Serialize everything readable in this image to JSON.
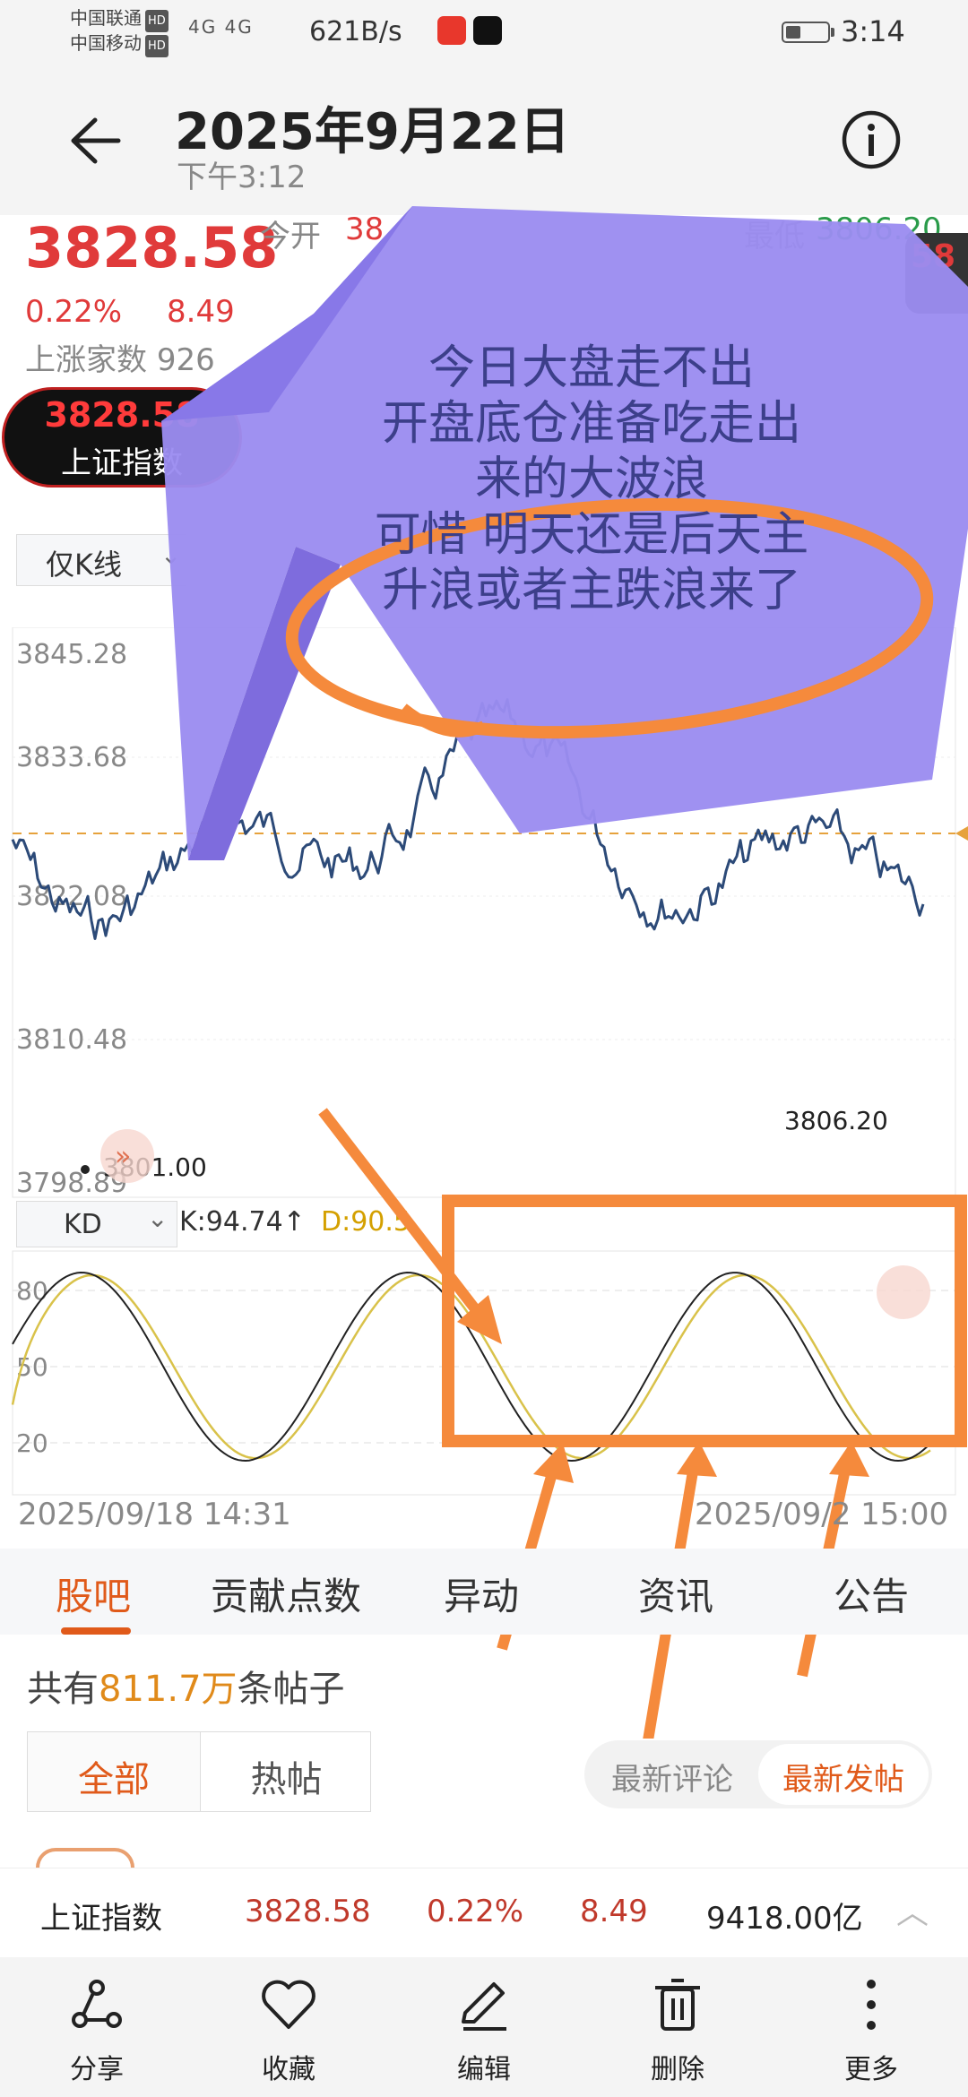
{
  "status": {
    "carrier1": "中国联通",
    "carrier2": "中国移动",
    "hd": "HD",
    "signal": "4G 4G",
    "netspeed": "621B/s",
    "time": "3:14"
  },
  "header": {
    "title": "2025年9月22日",
    "subtitle": "下午3:12"
  },
  "quote": {
    "price": "3828.58",
    "pct": "0.22%",
    "change": "8.49",
    "rise_label": "上涨家数",
    "rise_value": "926",
    "open_label": "今开",
    "open_value": "38",
    "low_label": "最低",
    "low_value": "3806.20",
    "right_value": "58",
    "pill_value": "3828.58",
    "pill_name": "上证指数"
  },
  "chart": {
    "mode": "仅K线",
    "y_ticks": [
      "3845.28",
      "3833.68",
      "3822.08",
      "3810.48",
      "3798.89"
    ],
    "low_label": "3801.00",
    "min_label": "3806.20"
  },
  "annotation": {
    "text_lines": [
      "今日大盘走不出",
      "开盘底仓准备吃走出",
      "来的大波浪",
      "可惜 明天还是后天主",
      "升浪或者主跌浪来了"
    ]
  },
  "kd": {
    "selector": "KD",
    "k": "K:94.74↑",
    "d": "D:90.5",
    "levels": [
      "80",
      "50",
      "20"
    ],
    "date_left": "2025/09/18 14:31",
    "date_right": "2025/09/2  15:00"
  },
  "tabs": [
    "股吧",
    "贡献点数",
    "异动",
    "资讯",
    "公告"
  ],
  "posts": {
    "prefix": "共有",
    "count": "811.7万",
    "suffix": "条帖子",
    "seg_all": "全部",
    "seg_hot": "热帖",
    "sort_comment": "最新评论",
    "sort_post": "最新发帖"
  },
  "ticker": {
    "name": "上证指数",
    "price": "3828.58",
    "pct": "0.22%",
    "change": "8.49",
    "volume": "9418.00亿"
  },
  "nav": [
    "分享",
    "收藏",
    "编辑",
    "删除",
    "更多"
  ],
  "colors": {
    "up": "#e03a3a",
    "down": "#2a9b4a",
    "accent": "#e05a1a",
    "bubble": "#9b8cf0",
    "annotation": "#f58a3c"
  }
}
